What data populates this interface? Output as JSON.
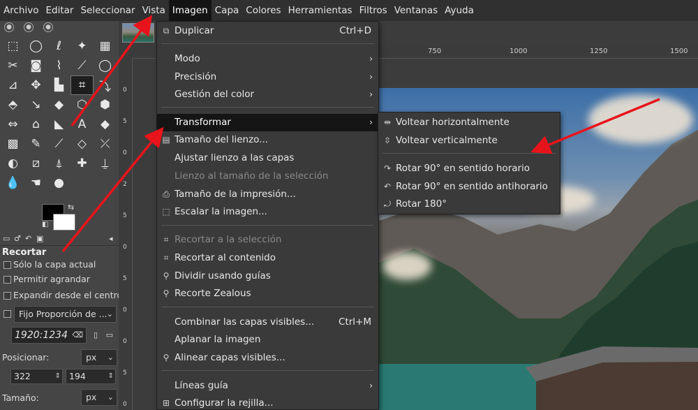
{
  "menubar": {
    "items": [
      "Archivo",
      "Editar",
      "Seleccionar",
      "Vista",
      "Imagen",
      "Capa",
      "Colores",
      "Herramientas",
      "Filtros",
      "Ventanas",
      "Ayuda"
    ]
  },
  "image_menu": {
    "items": [
      {
        "label": "Duplicar",
        "shortcut": "Ctrl+D",
        "icon": "duplicate-icon",
        "state": "enabled"
      },
      {
        "label": "Modo",
        "submenu": true,
        "state": "enabled"
      },
      {
        "label": "Precisión",
        "submenu": true,
        "state": "enabled"
      },
      {
        "label": "Gestión del color",
        "submenu": true,
        "state": "enabled"
      },
      {
        "label": "Transformar",
        "submenu": true,
        "state": "highlighted"
      },
      {
        "label": "Tamaño del lienzo...",
        "icon": "canvas-size-icon",
        "state": "enabled"
      },
      {
        "label": "Ajustar lienzo a las capas",
        "state": "enabled"
      },
      {
        "label": "Lienzo al tamaño de la selección",
        "state": "disabled"
      },
      {
        "label": "Tamaño de la impresión...",
        "icon": "print-size-icon",
        "state": "enabled"
      },
      {
        "label": "Escalar la imagen...",
        "icon": "scale-icon",
        "state": "enabled"
      },
      {
        "label": "Recortar a la selección",
        "icon": "crop-icon",
        "state": "disabled"
      },
      {
        "label": "Recortar al contenido",
        "icon": "crop-icon",
        "state": "enabled"
      },
      {
        "label": "Dividir usando guías",
        "icon": "guillotine-icon",
        "state": "enabled"
      },
      {
        "label": "Recorte Zealous",
        "icon": "zealous-crop-icon",
        "state": "enabled"
      },
      {
        "label": "Combinar las capas visibles...",
        "shortcut": "Ctrl+M",
        "state": "enabled"
      },
      {
        "label": "Aplanar la imagen",
        "state": "enabled"
      },
      {
        "label": "Alinear capas visibles...",
        "icon": "align-icon",
        "state": "enabled"
      },
      {
        "label": "Líneas guía",
        "submenu": true,
        "state": "enabled"
      },
      {
        "label": "Configurar la rejilla...",
        "icon": "grid-icon",
        "state": "enabled"
      }
    ]
  },
  "transform_menu": {
    "items": [
      {
        "label": "Voltear horizontalmente",
        "icon": "flip-horizontal-icon"
      },
      {
        "label": "Voltear verticalmente",
        "icon": "flip-vertical-icon"
      },
      {
        "label": "Rotar 90° en sentido horario",
        "icon": "rotate-cw-icon"
      },
      {
        "label": "Rotar 90° en sentido antihorario",
        "icon": "rotate-ccw-icon"
      },
      {
        "label": "Rotar 180°",
        "icon": "rotate-180-icon"
      }
    ]
  },
  "tool_options": {
    "title": "Recortar",
    "checkboxes": [
      "Sólo la capa actual",
      "Permitir agrandar",
      "Expandir desde el centro"
    ],
    "fixed_combo": "Fijo Proporción de ...",
    "ratio_value": "1920:1234",
    "position_label": "Posicionar:",
    "position_unit": "px",
    "position_x": "322",
    "position_y": "194",
    "size_label": "Tamaño:",
    "size_unit": "px"
  },
  "rulers": {
    "horizontal": [
      "750",
      "1000",
      "1250",
      "1500"
    ],
    "vertical": [
      "0",
      "5",
      "0",
      "2",
      "5",
      "0",
      "5",
      "0",
      "0",
      "5",
      "0"
    ]
  },
  "colors": {
    "menubar_bg": "#303030",
    "menu_bg": "#3a3a3a",
    "highlight_bg": "#151515",
    "annotation_arrow": "#e8141b",
    "toolbox_bg": "#454545"
  }
}
